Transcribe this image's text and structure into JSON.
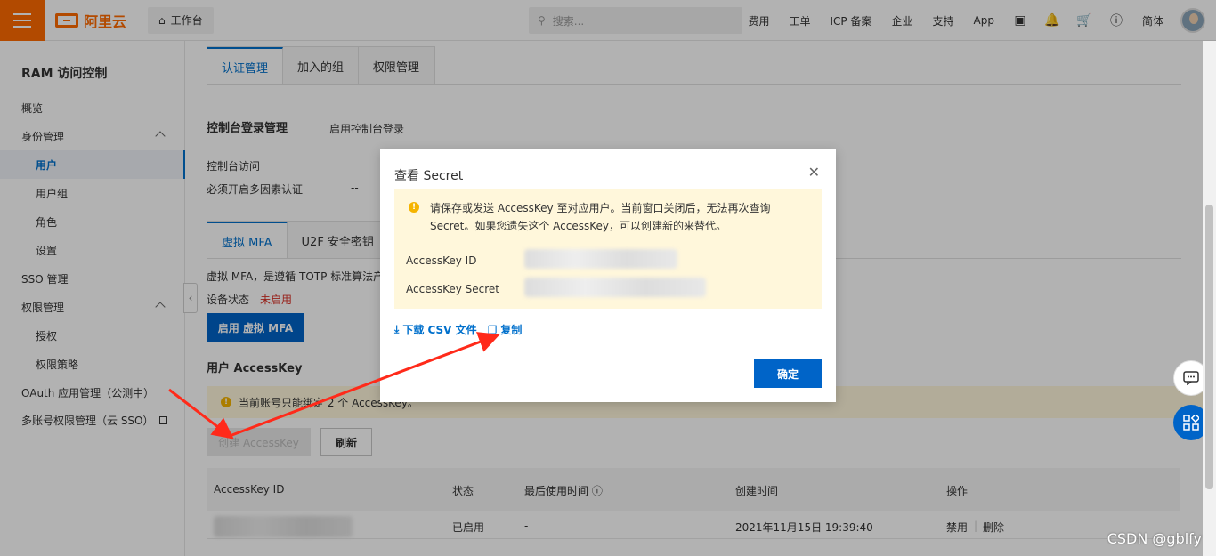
{
  "topbar": {
    "logo_text": "阿里云",
    "workbench": "工作台",
    "search_placeholder": "搜索...",
    "nav": [
      "费用",
      "工单",
      "ICP 备案",
      "企业",
      "支持",
      "App"
    ],
    "lang": "简体"
  },
  "sidebar": {
    "title": "RAM 访问控制",
    "overview": "概览",
    "identity": "身份管理",
    "users": "用户",
    "groups": "用户组",
    "roles": "角色",
    "settings": "设置",
    "sso": "SSO 管理",
    "permission": "权限管理",
    "grant": "授权",
    "policy": "权限策略",
    "oauth": "OAuth 应用管理（公测中）",
    "multi": "多账号权限管理（云 SSO）"
  },
  "tabs": [
    "认证管理",
    "加入的组",
    "权限管理"
  ],
  "console": {
    "title": "控制台登录管理",
    "enable_link": "启用控制台登录",
    "access_label": "控制台访问",
    "access_value": "--",
    "mfa_label": "必须开启多因素认证",
    "mfa_value": "--"
  },
  "mfa_tabs": [
    "虚拟 MFA",
    "U2F 安全密钥"
  ],
  "mfa": {
    "desc": "虚拟 MFA，是遵循 TOTP 标准算法产",
    "status_label": "设备状态",
    "status_value": "未启用",
    "enable_button": "启用 虚拟 MFA"
  },
  "accesskey": {
    "title": "用户 AccessKey",
    "warn_text": "当前账号只能绑定 2 个 AccessKey。",
    "create_button": "创建 AccessKey",
    "refresh_button": "刷新",
    "columns": [
      "AccessKey ID",
      "状态",
      "最后使用时间",
      "创建时间",
      "操作"
    ],
    "rows": [
      {
        "status": "已启用",
        "last_used": "-",
        "created": "2021年11月15日 19:39:40",
        "disable": "禁用",
        "delete": "删除"
      }
    ]
  },
  "modal": {
    "title": "查看 Secret",
    "notice": "请保存或发送 AccessKey 至对应用户。当前窗口关闭后，无法再次查询 Secret。如果您遗失这个 AccessKey，可以创建新的来替代。",
    "ak_id_label": "AccessKey ID",
    "ak_secret_label": "AccessKey Secret",
    "download": "下载 CSV 文件",
    "copy": "复制",
    "ok": "确定"
  },
  "watermark": "CSDN @gblfy",
  "colors": {
    "brand": "#ff6a00",
    "primary": "#0064c8",
    "link": "#0070cc",
    "warn_bg": "#fff7db",
    "annotation": "#ff2a1a"
  }
}
